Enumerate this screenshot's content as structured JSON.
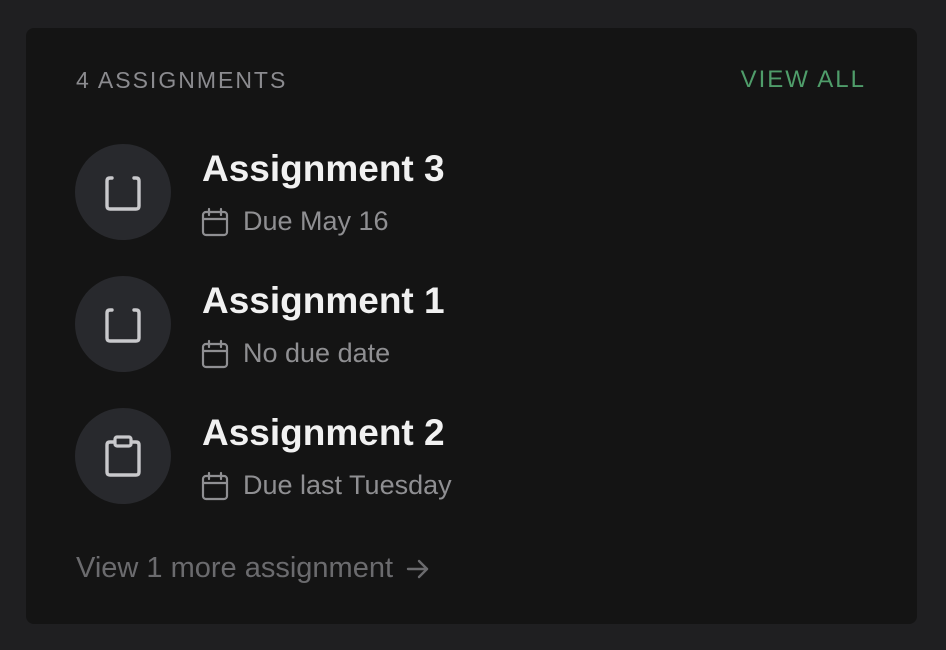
{
  "header": {
    "count_label": "4 ASSIGNMENTS",
    "view_all_label": "VIEW ALL"
  },
  "assignments": [
    {
      "title": "Assignment 3",
      "due": "Due May 16",
      "icon": "square-icon"
    },
    {
      "title": "Assignment 1",
      "due": "No due date",
      "icon": "square-icon"
    },
    {
      "title": "Assignment 2",
      "due": "Due last Tuesday",
      "icon": "clipboard-icon"
    }
  ],
  "footer": {
    "more_label": "View 1 more assignment",
    "more_icon": "arrow-right-icon"
  },
  "colors": {
    "accent": "#4f9d6a",
    "background": "#1f1f21",
    "card": "#141414"
  }
}
